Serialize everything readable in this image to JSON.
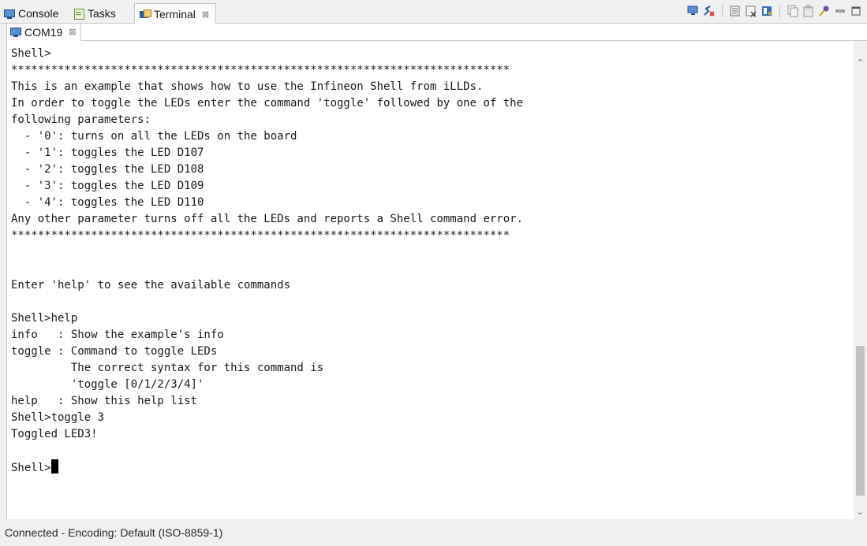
{
  "tabs": [
    {
      "label": "Console",
      "icon": "console-icon"
    },
    {
      "label": "Tasks",
      "icon": "tasks-icon"
    },
    {
      "label": "Terminal",
      "icon": "terminal-icon",
      "active": true
    }
  ],
  "close_glyph": "⊠",
  "toolbar_icons": [
    "connect-icon",
    "disconnect-icon",
    "settings-icon",
    "clear-icon",
    "scroll-lock-icon",
    "copy-icon",
    "paste-icon",
    "pin-icon",
    "minimize-icon",
    "maximize-icon"
  ],
  "terminal_tab": {
    "label": "COM19",
    "icon": "monitor-icon"
  },
  "terminal_lines": [
    "Shell>",
    "***************************************************************************",
    "This is an example that shows how to use the Infineon Shell from iLLDs.",
    "In order to toggle the LEDs enter the command 'toggle' followed by one of the",
    "following parameters:",
    "  - '0': turns on all the LEDs on the board",
    "  - '1': toggles the LED D107",
    "  - '2': toggles the LED D108",
    "  - '3': toggles the LED D109",
    "  - '4': toggles the LED D110",
    "Any other parameter turns off all the LEDs and reports a Shell command error.",
    "***************************************************************************",
    "",
    "",
    "Enter 'help' to see the available commands",
    "",
    "Shell>help",
    "info   : Show the example's info",
    "toggle : Command to toggle LEDs",
    "         The correct syntax for this command is",
    "         'toggle [0/1/2/3/4]'",
    "help   : Show this help list",
    "Shell>toggle 3",
    "Toggled LED3!",
    ""
  ],
  "prompt": "Shell>",
  "status": "Connected - Encoding: Default (ISO-8859-1)"
}
